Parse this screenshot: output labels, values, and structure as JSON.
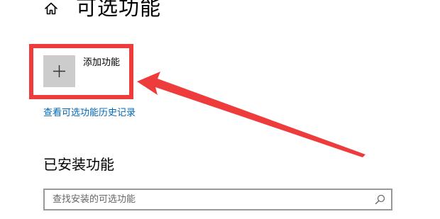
{
  "header": {
    "title": "可选功能",
    "home_icon": "home-icon"
  },
  "add_feature": {
    "label": "添加功能",
    "icon": "plus-icon"
  },
  "history_link": {
    "label": "查看可选功能历史记录"
  },
  "installed": {
    "heading": "已安装功能",
    "search": {
      "placeholder": "查找安装的可选功能",
      "value": "",
      "icon": "search-icon"
    }
  },
  "colors": {
    "accent_link": "#0067b8",
    "annotation": "#ee3b3b",
    "tile": "#cccccc",
    "search_border": "#999999"
  }
}
